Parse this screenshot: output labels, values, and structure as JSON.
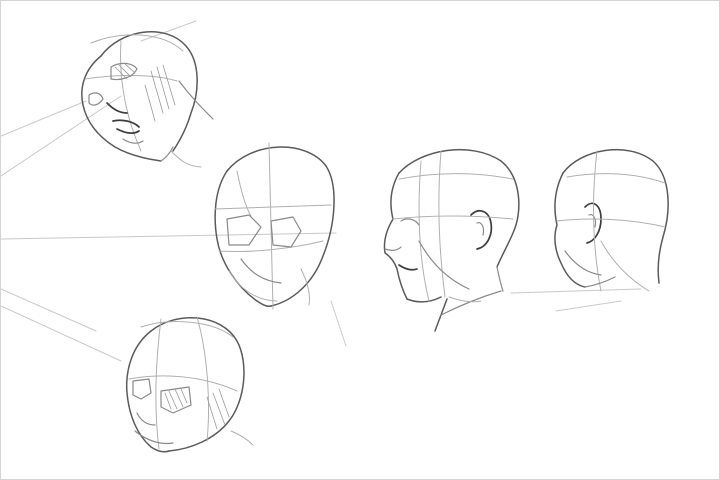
{
  "artwork": {
    "subject": "head-construction-sketches",
    "ink_color": "#5a5a5a",
    "background_color": "#ffffff",
    "border_color": "#d4d4d4"
  }
}
